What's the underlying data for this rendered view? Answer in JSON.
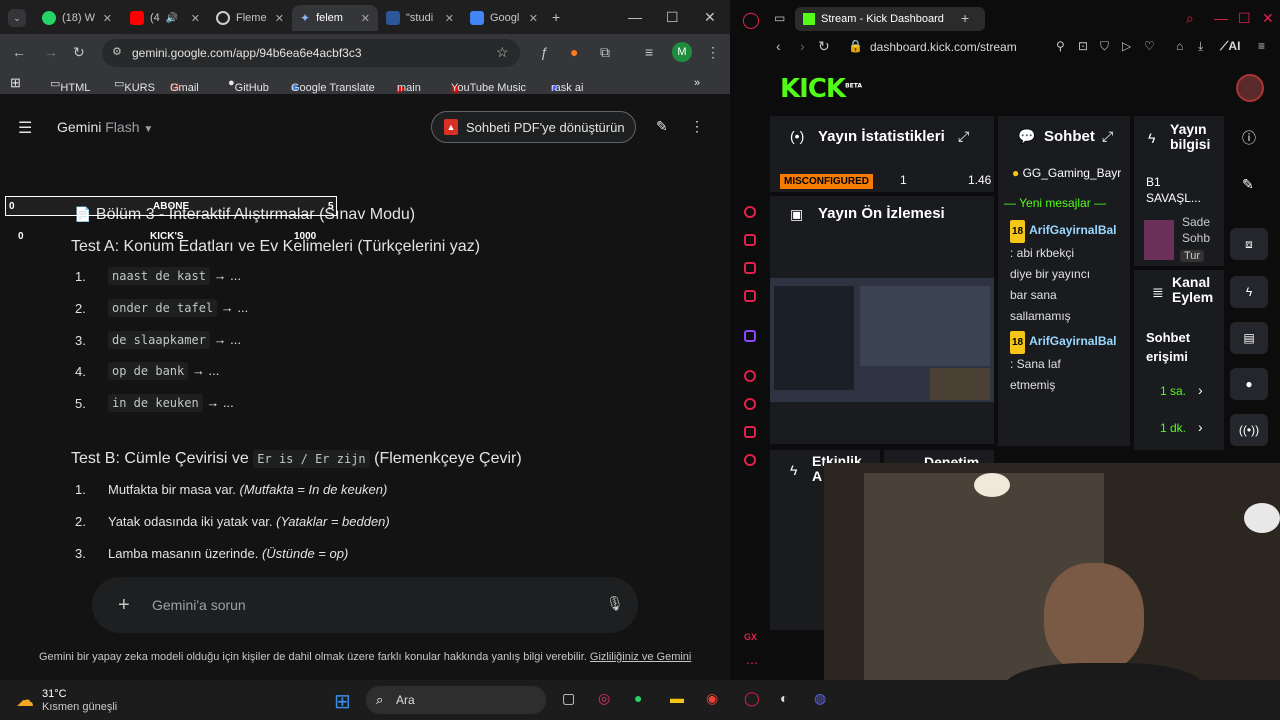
{
  "left_browser": {
    "tabs": [
      {
        "label": "(18) W",
        "favicon": "whatsapp-icon",
        "color": "#25d366"
      },
      {
        "label": "(4",
        "favicon": "youtube-icon",
        "color": "#ff0000"
      },
      {
        "label": "Fleme",
        "favicon": "globe-icon",
        "color": "#e3e3e3"
      },
      {
        "label": "felem",
        "favicon": "gemini-icon",
        "color": "#8ab4f8"
      },
      {
        "label": "\"studi",
        "favicon": "word-icon",
        "color": "#2b579a"
      },
      {
        "label": "Googl",
        "favicon": "translate-icon",
        "color": "#4285f4"
      }
    ],
    "url": "gemini.google.com/app/94b6ea6e4acbf3c3",
    "profile_letter": "M",
    "bookmarks": [
      "HTML",
      "KURS",
      "Gmail",
      "GitHub",
      "Google Translate",
      "main",
      "YouTube Music",
      "rask ai"
    ]
  },
  "gemini": {
    "model_name": "Gemini",
    "model_variant": "Flash",
    "pdf_button": "Sohbeti PDF'ye dönüştürün",
    "section_title": "Bölüm 3 - İnteraktif Alıştırmalar (Sınav Modu)",
    "testA_title": "Test A: Konum Edatları ve Ev Kelimeleri (Türkçelerini yaz)",
    "testA_items": [
      {
        "n": "1.",
        "code": "naast de kast",
        "tail": "→ ..."
      },
      {
        "n": "2.",
        "code": "onder de tafel",
        "tail": "→ ..."
      },
      {
        "n": "3.",
        "code": "de slaapkamer",
        "tail": "→ ..."
      },
      {
        "n": "4.",
        "code": "op de bank",
        "tail": "→ ..."
      },
      {
        "n": "5.",
        "code": "in de keuken",
        "tail": "→ ..."
      }
    ],
    "testB_prefix": "Test B: Cümle Çevirisi ve",
    "testB_code": "Er is / Er zijn",
    "testB_suffix": "(Flemenkçeye Çevir)",
    "testB_items": [
      {
        "n": "1.",
        "text": "Mutfakta bir masa var.",
        "hint": "(Mutfakta = In de keuken)"
      },
      {
        "n": "2.",
        "text": "Yatak odasında iki yatak var.",
        "hint": "(Yataklar = bedden)"
      },
      {
        "n": "3.",
        "text": "Lamba masanın üzerinde.",
        "hint": "(Üstünde = op)"
      }
    ],
    "prompt_placeholder": "Gemini'a sorun",
    "disclaimer": "Gemini bir yapay zeka modeli olduğu için kişiler de dahil olmak üzere farklı konular hakkında yanlış bilgi verebilir.",
    "disclaimer_link": "Gizliliğiniz ve Gemini"
  },
  "overlay": {
    "left_num": "0",
    "label": "ABONE",
    "right_num": "5",
    "zero": "0",
    "kicks_label": "KICK'S",
    "kicks_target": "1000"
  },
  "right_browser": {
    "tab_title": "Stream - Kick Dashboard",
    "url": "dashboard.kick.com/stream",
    "logo": "KICK",
    "logo_badge": "BETA",
    "stats_title": "Yayın İstatistikleri",
    "misconfigured": "MISCONFIGURED",
    "stat_1": "1",
    "stat_2": "1.46",
    "preview_title": "Yayın Ön İzlemesi",
    "chat_title": "Sohbet",
    "chat_user_top": "GG_Gaming_Bayr",
    "new_messages": "Yeni mesajlar",
    "messages": [
      {
        "badge": "18",
        "user": "ArifGayirnalBal",
        "lines": [
          ": abi rkbekçi",
          "diye bir yayıncı",
          "bar sana",
          "sallamamış"
        ]
      },
      {
        "badge": "18",
        "user": "ArifGayirnalBal",
        "lines": [
          ": Sana laf",
          "etmemiş"
        ]
      }
    ],
    "info_title_1": "Yayın",
    "info_title_2": "bilgisi",
    "info_stream_title": "B1",
    "info_stream_sub": "SAVAŞL...",
    "info_card_1": "Sade",
    "info_card_2": "Sohb",
    "info_card_tag": "Tur",
    "channel_title_1": "Kanal",
    "channel_title_2": "Eylem",
    "chat_access_1": "Sohbet",
    "chat_access_2": "erişimi",
    "access_opt1": "1 sa.",
    "access_opt2": "1 dk.",
    "activity_title_1": "Etkinlik",
    "activity_title_2": "A",
    "moderation_title": "Denetim",
    "accent": "#53fc18"
  },
  "taskbar": {
    "temp": "31°C",
    "weather": "Kısmen güneşli",
    "search": "Ara"
  }
}
